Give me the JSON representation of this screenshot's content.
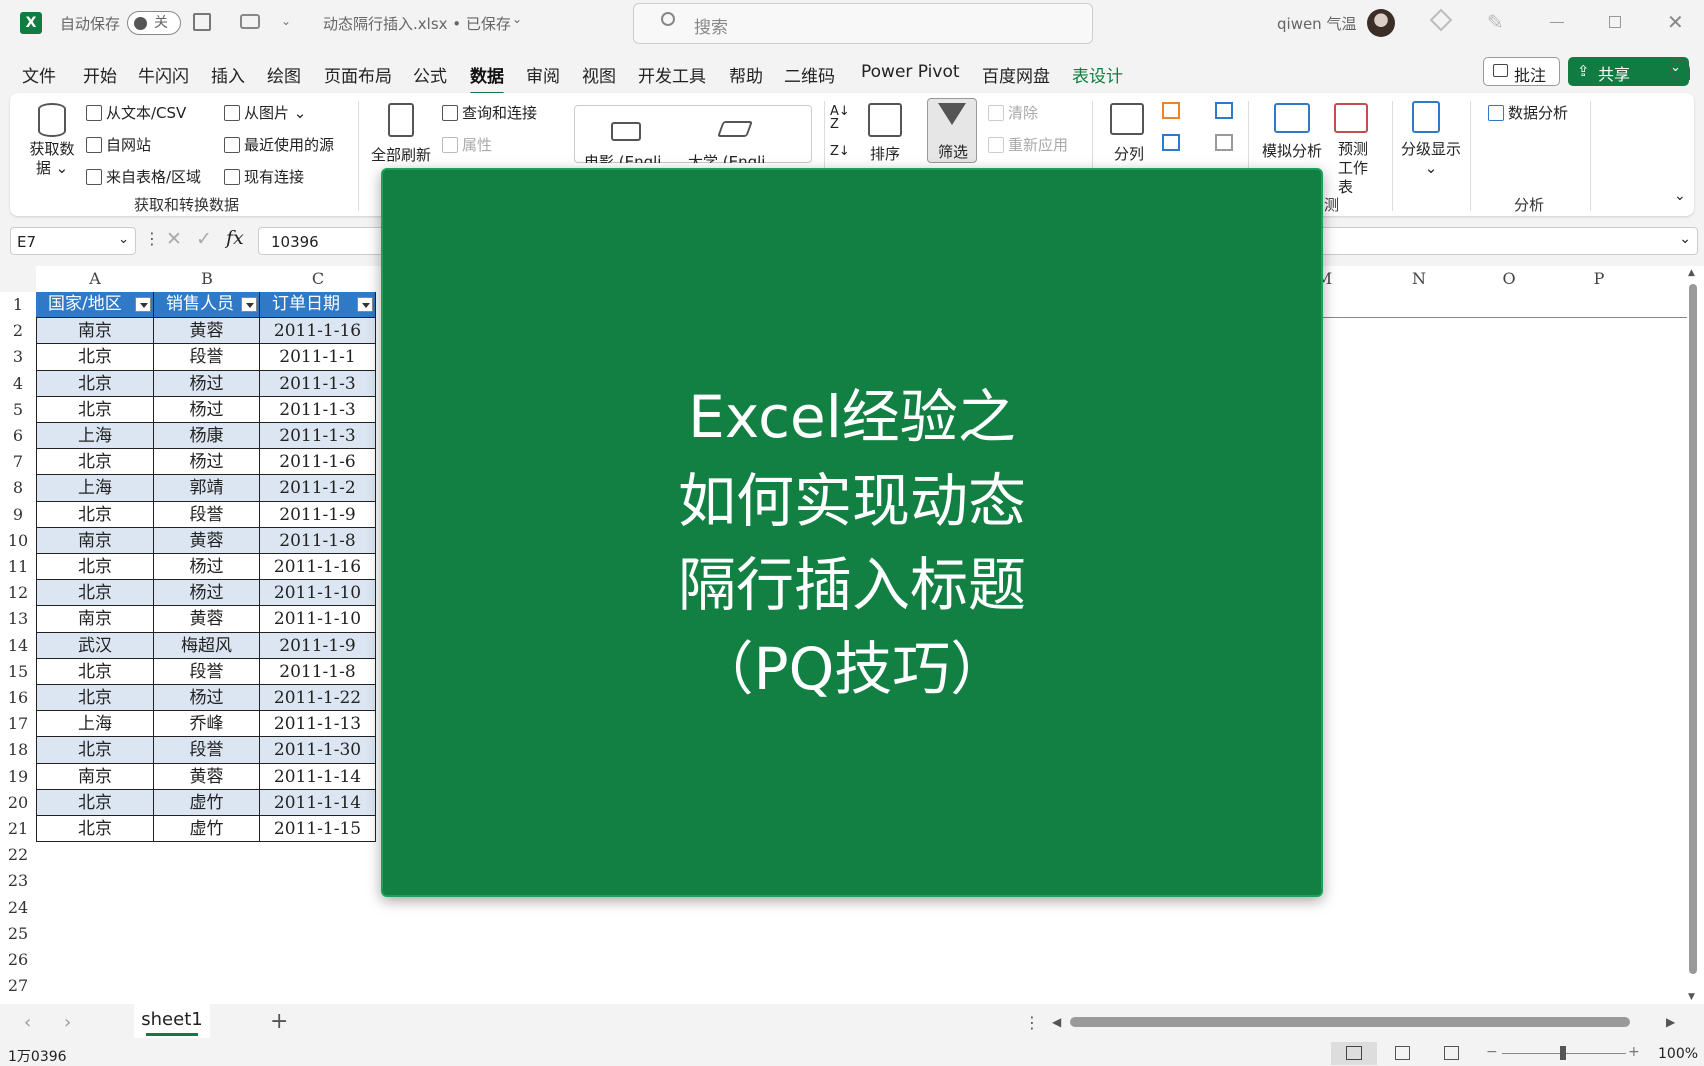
{
  "titlebar": {
    "autosave_label": "自动保存",
    "autosave_state": "关",
    "filename": "动态隔行插入.xlsx • 已保存",
    "search_placeholder": "搜索",
    "user": "qiwen 气温"
  },
  "menu": {
    "items": [
      "文件",
      "开始",
      "牛闪闪",
      "插入",
      "绘图",
      "页面布局",
      "公式",
      "数据",
      "审阅",
      "视图",
      "开发工具",
      "帮助",
      "二维码",
      "Power Pivot",
      "百度网盘",
      "表设计"
    ],
    "active": "数据",
    "comment_button": "批注",
    "share_button": "共享"
  },
  "ribbon": {
    "get_data": "获取数据",
    "from_text_csv": "从文本/CSV",
    "from_web": "自网站",
    "from_table": "来自表格/区域",
    "from_picture": "从图片",
    "recent_sources": "最近使用的源",
    "existing_connections": "现有连接",
    "group_get_transform": "获取和转换数据",
    "refresh_all": "全部刷新",
    "queries_connections": "查询和连接",
    "properties": "属性",
    "datatype_movie": "电影 (Engli",
    "datatype_university": "大学 (Engli",
    "sort": "排序",
    "filter": "筛选",
    "clear": "清除",
    "reapply": "重新应用",
    "text_to_columns": "分列",
    "whatif": "模拟分析",
    "forecast_sheet": "预测工作表",
    "outline": "分级显示",
    "data_analysis": "数据分析",
    "group_forecast_partial": "测",
    "group_analysis": "分析"
  },
  "formula_bar": {
    "name_box": "E7",
    "formula": "10396"
  },
  "sheet": {
    "columns_visible": [
      "A",
      "B",
      "C",
      "M",
      "N",
      "O",
      "P"
    ],
    "headers": [
      "国家/地区",
      "销售人员",
      "订单日期"
    ],
    "rows": [
      [
        "南京",
        "黄蓉",
        "2011-1-16"
      ],
      [
        "北京",
        "段誉",
        "2011-1-1"
      ],
      [
        "北京",
        "杨过",
        "2011-1-3"
      ],
      [
        "北京",
        "杨过",
        "2011-1-3"
      ],
      [
        "上海",
        "杨康",
        "2011-1-3"
      ],
      [
        "北京",
        "杨过",
        "2011-1-6"
      ],
      [
        "上海",
        "郭靖",
        "2011-1-2"
      ],
      [
        "北京",
        "段誉",
        "2011-1-9"
      ],
      [
        "南京",
        "黄蓉",
        "2011-1-8"
      ],
      [
        "北京",
        "杨过",
        "2011-1-16"
      ],
      [
        "北京",
        "杨过",
        "2011-1-10"
      ],
      [
        "南京",
        "黄蓉",
        "2011-1-10"
      ],
      [
        "武汉",
        "梅超风",
        "2011-1-9"
      ],
      [
        "北京",
        "段誉",
        "2011-1-8"
      ],
      [
        "北京",
        "杨过",
        "2011-1-22"
      ],
      [
        "上海",
        "乔峰",
        "2011-1-13"
      ],
      [
        "北京",
        "段誉",
        "2011-1-30"
      ],
      [
        "南京",
        "黄蓉",
        "2011-1-14"
      ],
      [
        "北京",
        "虚竹",
        "2011-1-14"
      ],
      [
        "北京",
        "虚竹",
        "2011-1-15"
      ]
    ],
    "row_numbers": [
      "1",
      "2",
      "3",
      "4",
      "5",
      "6",
      "7",
      "8",
      "9",
      "10",
      "11",
      "12",
      "13",
      "14",
      "15",
      "16",
      "17",
      "18",
      "19",
      "20",
      "21",
      "22",
      "23",
      "24",
      "25",
      "26",
      "27"
    ],
    "tab_name": "sheet1"
  },
  "overlay": {
    "lines": [
      "Excel经验之",
      "如何实现动态",
      "隔行插入标题",
      "（PQ技巧）"
    ]
  },
  "status": {
    "left": "1万0396",
    "zoom": "100%"
  },
  "colors": {
    "excel_green": "#107c41",
    "table_header": "#2f79c6",
    "band_row": "#dce6f2",
    "overlay_bg": "#127f43"
  }
}
